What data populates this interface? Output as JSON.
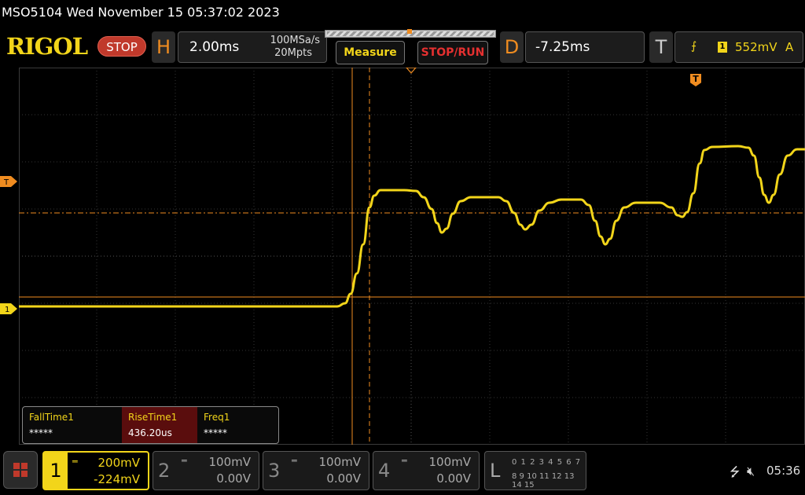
{
  "title": "MSO5104  Wed November 15 05:37:02 2023",
  "logo": "RIGOL",
  "run_state": "STOP",
  "horizontal": {
    "label": "H",
    "timebase": "2.00ms",
    "sample_rate": "100MSa/s",
    "memory_depth": "20Mpts"
  },
  "buttons": {
    "measure": "Measure",
    "stop_run": "STOP/RUN"
  },
  "delay": {
    "label": "D",
    "value": "-7.25ms"
  },
  "trigger": {
    "label": "T",
    "source": "1",
    "level": "552mV",
    "mode": "A",
    "edge_icon": "rising-edge-icon",
    "marker": "T"
  },
  "channel_marker": "1",
  "measurements": [
    {
      "name": "FallTime1",
      "value": "*****"
    },
    {
      "name": "RiseTime1",
      "value": "436.20us"
    },
    {
      "name": "Freq1",
      "value": "*****"
    }
  ],
  "channels": [
    {
      "num": "1",
      "scale": "200mV",
      "offset": "-224mV"
    },
    {
      "num": "2",
      "scale": "100mV",
      "offset": "0.00V"
    },
    {
      "num": "3",
      "scale": "100mV",
      "offset": "0.00V"
    },
    {
      "num": "4",
      "scale": "100mV",
      "offset": "0.00V"
    }
  ],
  "logic": {
    "label": "L",
    "row1": "0 1 2 3  4 5 6 7",
    "row2": "8 9 10 11 12 13 14 15"
  },
  "status": {
    "time": "05:36",
    "usb_icon": "usb-icon",
    "speaker_icon": "mute-speaker-icon"
  },
  "colors": {
    "trace": "#f2d51a",
    "accent": "#f08c20",
    "stop": "#c0392b"
  }
}
